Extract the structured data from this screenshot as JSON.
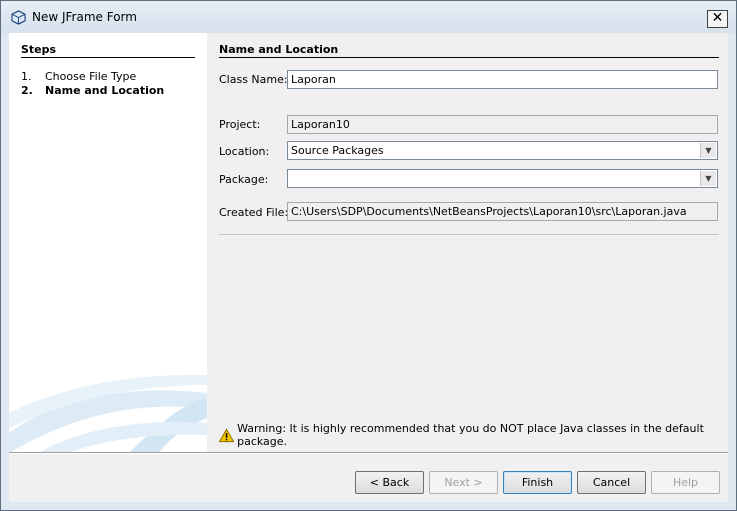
{
  "window": {
    "title": "New JFrame Form",
    "close_glyph": "✕"
  },
  "steps": {
    "title": "Steps",
    "items": [
      {
        "num": "1.",
        "label": "Choose File Type"
      },
      {
        "num": "2.",
        "label": "Name and Location"
      }
    ]
  },
  "form": {
    "section_title": "Name and Location",
    "class_name": {
      "label": "Class Name:",
      "value": "Laporan"
    },
    "project": {
      "label": "Project:",
      "value": "Laporan10"
    },
    "location": {
      "label": "Location:",
      "value": "Source Packages"
    },
    "package": {
      "label": "Package:",
      "value": ""
    },
    "created_file": {
      "label": "Created File:",
      "value": "C:\\Users\\SDP\\Documents\\NetBeansProjects\\Laporan10\\src\\Laporan.java"
    },
    "warning": "Warning: It is highly recommended that you do NOT place Java classes in the default package."
  },
  "buttons": {
    "back": "< Back",
    "next": "Next >",
    "finish": "Finish",
    "cancel": "Cancel",
    "help": "Help"
  },
  "icons": {
    "window": "netbeans-cube-icon",
    "warning": "warning-triangle-icon",
    "dropdown": "chevron-down-icon"
  },
  "colors": {
    "window_bg": "#dfe8f1",
    "panel_bg": "#f0f0f0",
    "steps_bg": "#ffffff",
    "default_button_border": "#3c7fb1",
    "warning_yellow": "#f5c400"
  }
}
